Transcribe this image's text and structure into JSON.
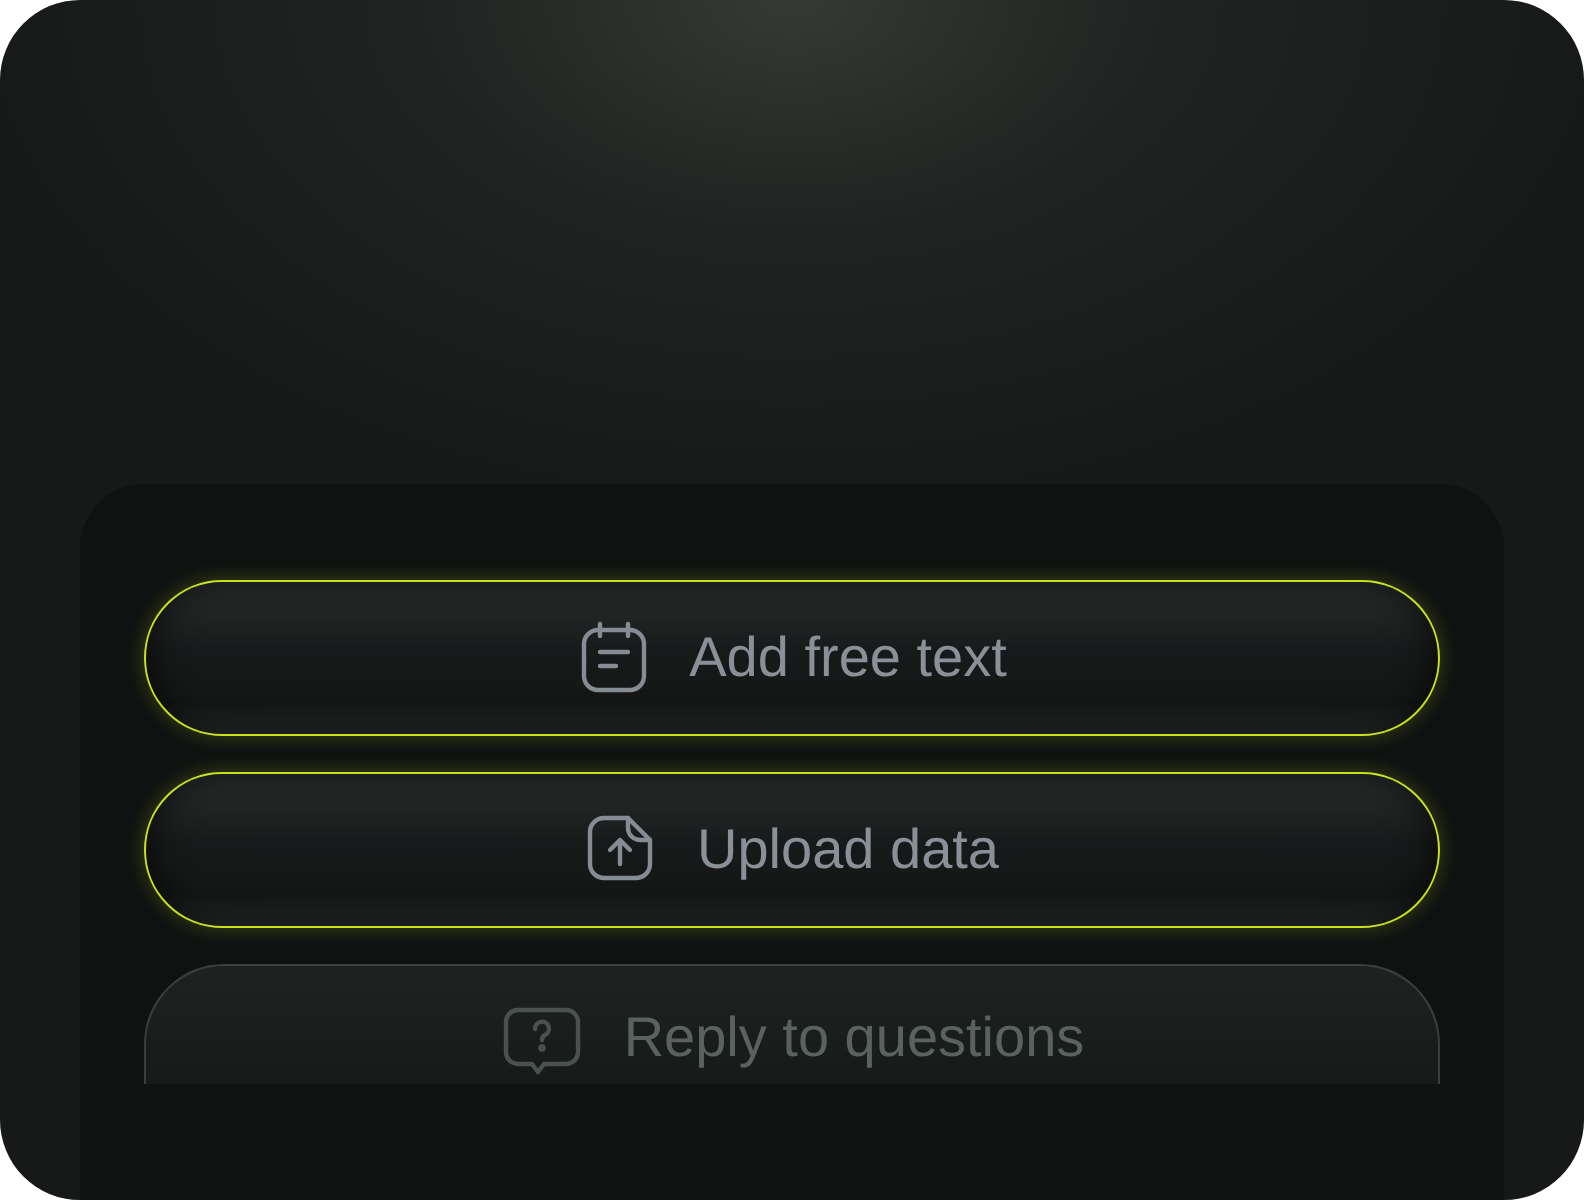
{
  "options": [
    {
      "label": "Add free text",
      "faded": false
    },
    {
      "label": "Upload data",
      "faded": false
    },
    {
      "label": "Reply to questions",
      "faded": true
    }
  ]
}
